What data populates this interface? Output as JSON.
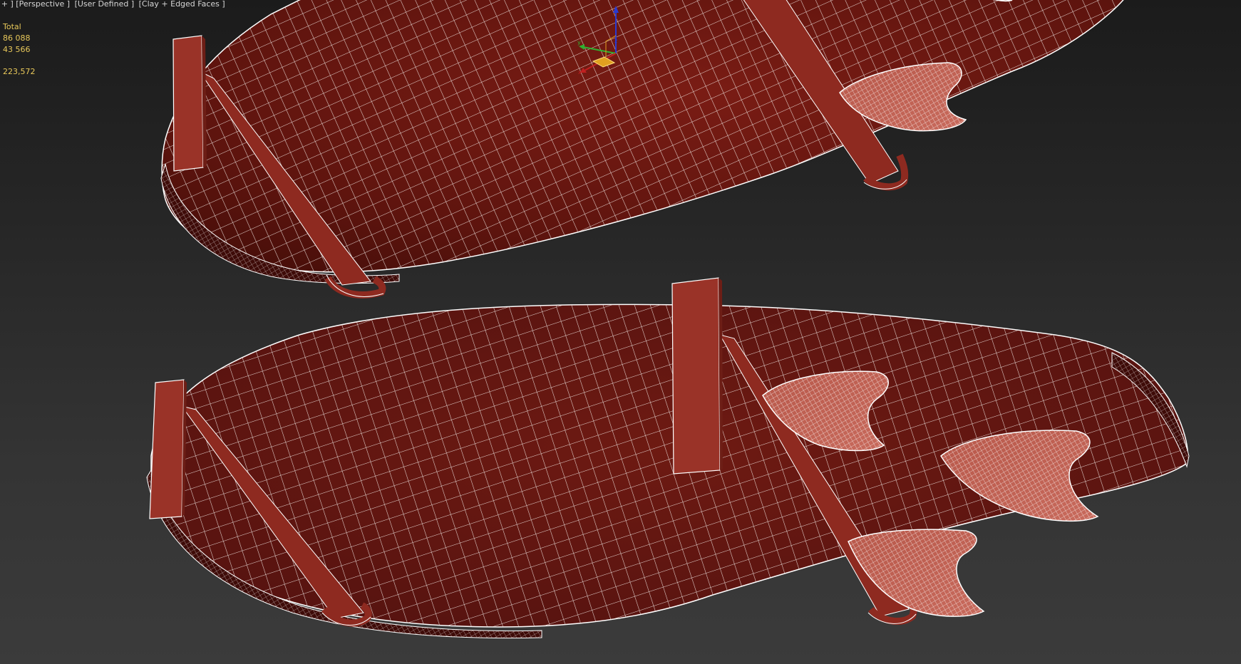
{
  "viewport": {
    "labels": [
      "[ + ] [Perspective ]",
      "[User Defined ]",
      "[Clay + Edged Faces ]"
    ],
    "stats": {
      "header": "Total",
      "polys": "86 088",
      "verts": "43 566",
      "fps": "223,572"
    },
    "colors": {
      "background_top": "#1b1b1b",
      "background_bottom": "#3b3b3b",
      "stats_text": "#e8c85a",
      "clay": "#8e2a20",
      "wire": "#ffffff",
      "gizmo_x": "#c02020",
      "gizmo_y": "#30b030",
      "gizmo_z": "#2a3ad0",
      "gizmo_plane": "#e0a020"
    },
    "gizmo": "transform-gizmo-icon"
  }
}
